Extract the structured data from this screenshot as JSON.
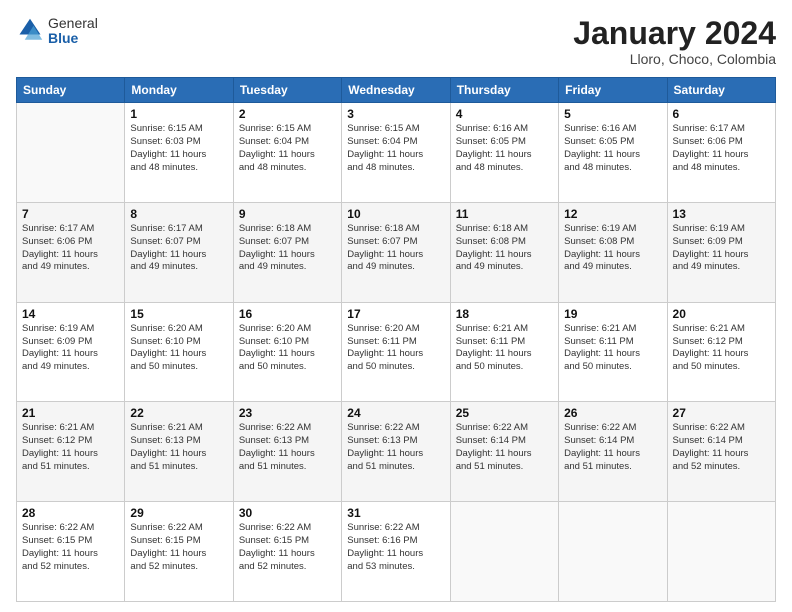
{
  "logo": {
    "general": "General",
    "blue": "Blue"
  },
  "title": "January 2024",
  "location": "Lloro, Choco, Colombia",
  "days_header": [
    "Sunday",
    "Monday",
    "Tuesday",
    "Wednesday",
    "Thursday",
    "Friday",
    "Saturday"
  ],
  "weeks": [
    [
      {
        "day": "",
        "info": ""
      },
      {
        "day": "1",
        "info": "Sunrise: 6:15 AM\nSunset: 6:03 PM\nDaylight: 11 hours\nand 48 minutes."
      },
      {
        "day": "2",
        "info": "Sunrise: 6:15 AM\nSunset: 6:04 PM\nDaylight: 11 hours\nand 48 minutes."
      },
      {
        "day": "3",
        "info": "Sunrise: 6:15 AM\nSunset: 6:04 PM\nDaylight: 11 hours\nand 48 minutes."
      },
      {
        "day": "4",
        "info": "Sunrise: 6:16 AM\nSunset: 6:05 PM\nDaylight: 11 hours\nand 48 minutes."
      },
      {
        "day": "5",
        "info": "Sunrise: 6:16 AM\nSunset: 6:05 PM\nDaylight: 11 hours\nand 48 minutes."
      },
      {
        "day": "6",
        "info": "Sunrise: 6:17 AM\nSunset: 6:06 PM\nDaylight: 11 hours\nand 48 minutes."
      }
    ],
    [
      {
        "day": "7",
        "info": "Sunrise: 6:17 AM\nSunset: 6:06 PM\nDaylight: 11 hours\nand 49 minutes."
      },
      {
        "day": "8",
        "info": "Sunrise: 6:17 AM\nSunset: 6:07 PM\nDaylight: 11 hours\nand 49 minutes."
      },
      {
        "day": "9",
        "info": "Sunrise: 6:18 AM\nSunset: 6:07 PM\nDaylight: 11 hours\nand 49 minutes."
      },
      {
        "day": "10",
        "info": "Sunrise: 6:18 AM\nSunset: 6:07 PM\nDaylight: 11 hours\nand 49 minutes."
      },
      {
        "day": "11",
        "info": "Sunrise: 6:18 AM\nSunset: 6:08 PM\nDaylight: 11 hours\nand 49 minutes."
      },
      {
        "day": "12",
        "info": "Sunrise: 6:19 AM\nSunset: 6:08 PM\nDaylight: 11 hours\nand 49 minutes."
      },
      {
        "day": "13",
        "info": "Sunrise: 6:19 AM\nSunset: 6:09 PM\nDaylight: 11 hours\nand 49 minutes."
      }
    ],
    [
      {
        "day": "14",
        "info": "Sunrise: 6:19 AM\nSunset: 6:09 PM\nDaylight: 11 hours\nand 49 minutes."
      },
      {
        "day": "15",
        "info": "Sunrise: 6:20 AM\nSunset: 6:10 PM\nDaylight: 11 hours\nand 50 minutes."
      },
      {
        "day": "16",
        "info": "Sunrise: 6:20 AM\nSunset: 6:10 PM\nDaylight: 11 hours\nand 50 minutes."
      },
      {
        "day": "17",
        "info": "Sunrise: 6:20 AM\nSunset: 6:11 PM\nDaylight: 11 hours\nand 50 minutes."
      },
      {
        "day": "18",
        "info": "Sunrise: 6:21 AM\nSunset: 6:11 PM\nDaylight: 11 hours\nand 50 minutes."
      },
      {
        "day": "19",
        "info": "Sunrise: 6:21 AM\nSunset: 6:11 PM\nDaylight: 11 hours\nand 50 minutes."
      },
      {
        "day": "20",
        "info": "Sunrise: 6:21 AM\nSunset: 6:12 PM\nDaylight: 11 hours\nand 50 minutes."
      }
    ],
    [
      {
        "day": "21",
        "info": "Sunrise: 6:21 AM\nSunset: 6:12 PM\nDaylight: 11 hours\nand 51 minutes."
      },
      {
        "day": "22",
        "info": "Sunrise: 6:21 AM\nSunset: 6:13 PM\nDaylight: 11 hours\nand 51 minutes."
      },
      {
        "day": "23",
        "info": "Sunrise: 6:22 AM\nSunset: 6:13 PM\nDaylight: 11 hours\nand 51 minutes."
      },
      {
        "day": "24",
        "info": "Sunrise: 6:22 AM\nSunset: 6:13 PM\nDaylight: 11 hours\nand 51 minutes."
      },
      {
        "day": "25",
        "info": "Sunrise: 6:22 AM\nSunset: 6:14 PM\nDaylight: 11 hours\nand 51 minutes."
      },
      {
        "day": "26",
        "info": "Sunrise: 6:22 AM\nSunset: 6:14 PM\nDaylight: 11 hours\nand 51 minutes."
      },
      {
        "day": "27",
        "info": "Sunrise: 6:22 AM\nSunset: 6:14 PM\nDaylight: 11 hours\nand 52 minutes."
      }
    ],
    [
      {
        "day": "28",
        "info": "Sunrise: 6:22 AM\nSunset: 6:15 PM\nDaylight: 11 hours\nand 52 minutes."
      },
      {
        "day": "29",
        "info": "Sunrise: 6:22 AM\nSunset: 6:15 PM\nDaylight: 11 hours\nand 52 minutes."
      },
      {
        "day": "30",
        "info": "Sunrise: 6:22 AM\nSunset: 6:15 PM\nDaylight: 11 hours\nand 52 minutes."
      },
      {
        "day": "31",
        "info": "Sunrise: 6:22 AM\nSunset: 6:16 PM\nDaylight: 11 hours\nand 53 minutes."
      },
      {
        "day": "",
        "info": ""
      },
      {
        "day": "",
        "info": ""
      },
      {
        "day": "",
        "info": ""
      }
    ]
  ]
}
